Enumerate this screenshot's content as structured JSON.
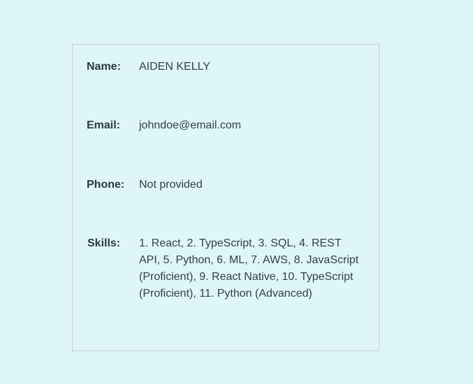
{
  "profile": {
    "name_label": "Name:",
    "name_value": "AIDEN KELLY",
    "email_label": "Email:",
    "email_value": "johndoe@email.com",
    "phone_label": "Phone:",
    "phone_value": "Not provided",
    "skills_label": "Skills:",
    "skills_value": "1. React, 2. TypeScript, 3. SQL, 4. REST API, 5. Python, 6. ML, 7. AWS, 8. JavaScript (Proficient), 9. React Native, 10. TypeScript (Proficient), 11. Python (Advanced)"
  },
  "colors": {
    "background": "#def6f8",
    "border": "#c8d0d3",
    "text": "#2b3a42"
  }
}
